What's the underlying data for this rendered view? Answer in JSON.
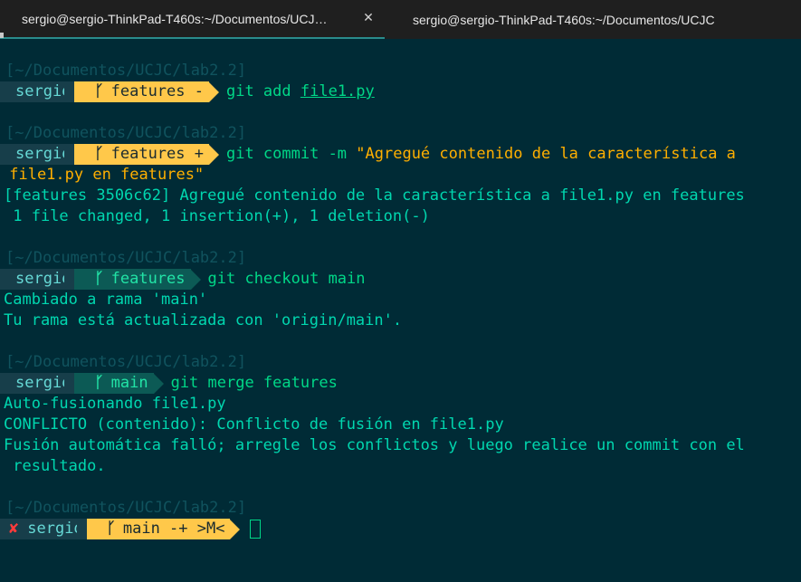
{
  "tabs": [
    {
      "title": "sergio@sergio-ThinkPad-T460s:~/Documentos/UCJ…",
      "close": "✕"
    },
    {
      "title": "sergio@sergio-ThinkPad-T460s:~/Documentos/UCJC"
    }
  ],
  "path": "[~/Documentos/UCJC/lab2.2]",
  "user": "sergio",
  "branch_glyph": "ᚴ",
  "blocks": [
    {
      "branch": "features -",
      "cmd_a": "git add ",
      "cmd_b": "file1.py"
    },
    {
      "branch": "features +",
      "cmd_a": "git commit -m ",
      "str_1": "\"Agregué contenido de la característica a",
      "str_2": " file1.py en features\"",
      "out": [
        "[features 3506c62] Agregué contenido de la característica a file1.py en features",
        " 1 file changed, 1 insertion(+), 1 deletion(-)"
      ]
    },
    {
      "branch": "features",
      "cmd": "git checkout main",
      "out": [
        "Cambiado a rama 'main'",
        "Tu rama está actualizada con 'origin/main'."
      ]
    },
    {
      "branch": "main",
      "cmd": "git merge features",
      "out": [
        "Auto-fusionando file1.py",
        "CONFLICTO (contenido): Conflicto de fusión en file1.py",
        "Fusión automática falló; arregle los conflictos y luego realice un commit con el",
        " resultado."
      ]
    },
    {
      "status": "✘",
      "branch": "main -+ >M<"
    }
  ]
}
